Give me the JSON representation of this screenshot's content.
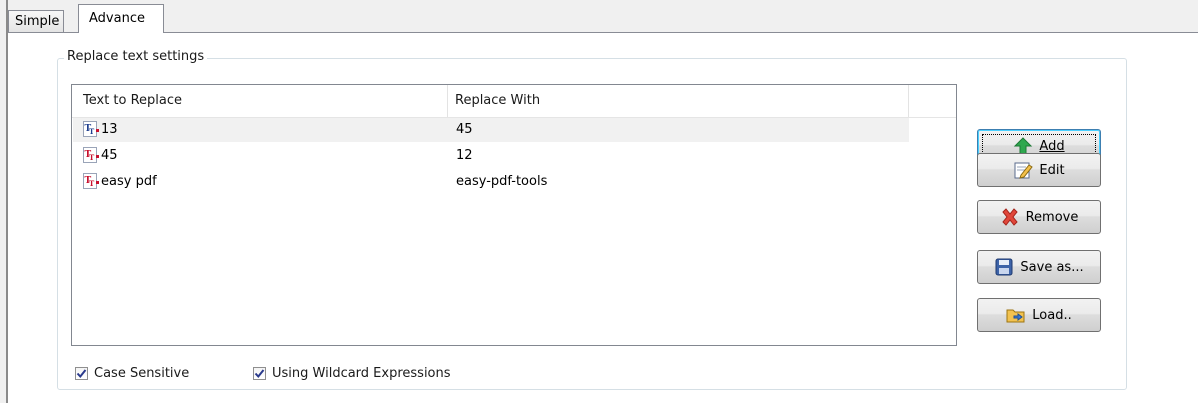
{
  "tabs": [
    {
      "label": "Simple",
      "active": false
    },
    {
      "label": "Advance",
      "active": true
    }
  ],
  "group": {
    "title": "Replace text settings"
  },
  "table": {
    "columns": [
      "Text to Replace",
      "Replace With",
      ""
    ],
    "rows": [
      {
        "find": "13",
        "replace": "45",
        "selected": true
      },
      {
        "find": "45",
        "replace": "12",
        "selected": false
      },
      {
        "find": "easy pdf",
        "replace": "easy-pdf-tools",
        "selected": false
      }
    ]
  },
  "buttons": {
    "add": {
      "label": "Add",
      "icon": "arrow-up-icon"
    },
    "edit": {
      "label": "Edit",
      "icon": "edit-icon"
    },
    "remove": {
      "label": "Remove",
      "icon": "remove-x-icon"
    },
    "save_as": {
      "label": "Save as...",
      "icon": "save-icon"
    },
    "load": {
      "label": "Load..",
      "icon": "load-folder-icon"
    }
  },
  "checkboxes": {
    "case_sensitive": {
      "label": "Case Sensitive",
      "checked": true
    },
    "wildcard": {
      "label": "Using Wildcard Expressions",
      "checked": true
    }
  },
  "colors": {
    "accent": "#3c7fb1",
    "icon_red": "#c8102e",
    "arrow_green": "#2fa84f"
  }
}
